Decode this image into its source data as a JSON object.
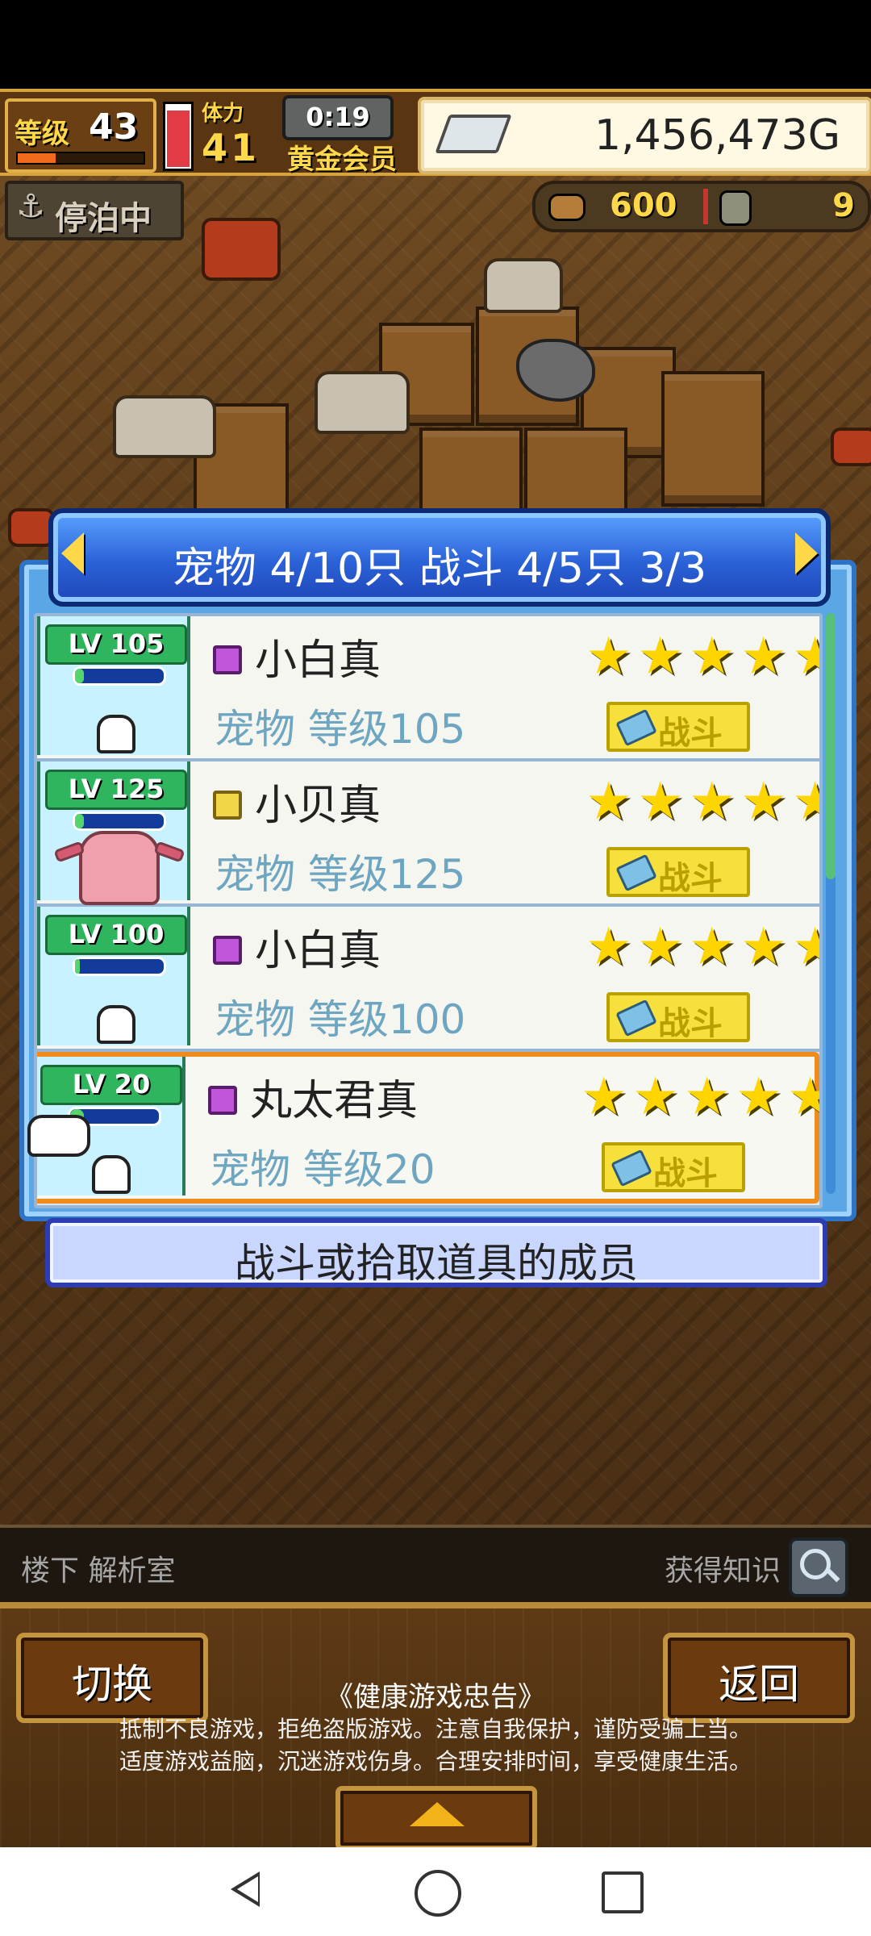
{
  "hud": {
    "level_label": "等级",
    "level_value": "43",
    "exp_percent": 30,
    "stamina_label": "体力",
    "stamina_value": "41",
    "stamina_percent": 95,
    "timer": "0:19",
    "member_label": "黄金会员",
    "gold_value": "1,456,473G"
  },
  "status": {
    "docked_label": "停泊中",
    "food_value": "600",
    "stone_value": "9"
  },
  "dialog": {
    "title": "宠物 4/10只 战斗 4/5只  3/3",
    "pets": [
      {
        "lv_label": "LV 105",
        "exp_percent": 0.1,
        "name": "小白真",
        "sub": "宠物 等级105",
        "stars": 5,
        "battle_label": "战斗"
      },
      {
        "lv_label": "LV 125",
        "exp_percent": 0.1,
        "name": "小贝真",
        "sub": "宠物 等级125",
        "stars": 5,
        "battle_label": "战斗"
      },
      {
        "lv_label": "LV 100",
        "exp_percent": 0.05,
        "name": "小白真",
        "sub": "宠物 等级100",
        "stars": 5,
        "battle_label": "战斗"
      },
      {
        "lv_label": "LV  20",
        "exp_percent": 0.15,
        "name": "丸太君真",
        "sub": "宠物 等级20",
        "stars": 5,
        "battle_label": "战斗"
      }
    ],
    "info_text": "战斗或拾取道具的成员"
  },
  "bottom": {
    "location": "楼下 解析室",
    "knowledge_label": "获得知识",
    "switch_label": "切换",
    "back_label": "返回",
    "advisory_title": "《健康游戏忠告》",
    "advisory_line1": "抵制不良游戏，拒绝盗版游戏。注意自我保护，谨防受骗上当。",
    "advisory_line2": "适度游戏益脑，沉迷游戏伤身。合理安排时间，享受健康生活。"
  },
  "icons": {
    "gold": "silver-bar-icon",
    "anchor": "anchor-icon",
    "food": "food-icon",
    "stone": "stone-icon",
    "magnifier": "magnifier-icon",
    "hand": "hand-pointer-icon",
    "sword": "sword-icon",
    "gem_purple": "purple-gem-icon",
    "gem_gold": "gold-gem-icon"
  }
}
